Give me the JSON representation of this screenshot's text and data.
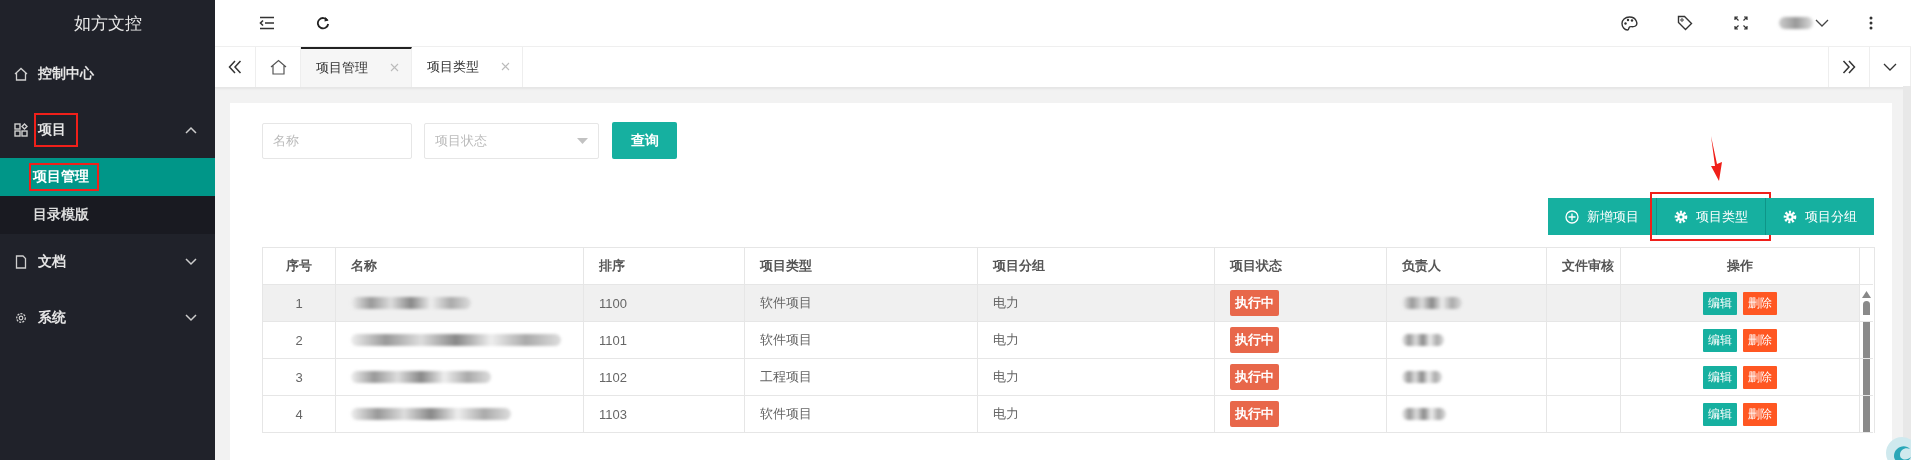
{
  "sidebar": {
    "title": "如方文控",
    "items": [
      {
        "label": "控制中心",
        "kind": "link"
      },
      {
        "label": "项目",
        "kind": "group",
        "expanded": true,
        "annotated": true,
        "children": [
          {
            "label": "项目管理",
            "selected": true,
            "annotated": true
          },
          {
            "label": "目录模版",
            "selected": false,
            "annotated": false
          }
        ]
      },
      {
        "label": "文档",
        "kind": "group",
        "expanded": false,
        "annotated": false
      },
      {
        "label": "系统",
        "kind": "group",
        "expanded": false,
        "annotated": false
      }
    ]
  },
  "tabs": [
    {
      "label": "项目管理",
      "selected": true
    },
    {
      "label": "项目类型",
      "selected": false
    }
  ],
  "search": {
    "name_placeholder": "名称",
    "status_placeholder": "项目状态",
    "button": "查询"
  },
  "toolbar": [
    {
      "label": "新增项目",
      "kind": "add",
      "annotated": false
    },
    {
      "label": "项目类型",
      "kind": "settings",
      "annotated": true
    },
    {
      "label": "项目分组",
      "kind": "settings",
      "annotated": false
    }
  ],
  "table": {
    "columns": [
      "序号",
      "名称",
      "排序",
      "项目类型",
      "项目分组",
      "项目状态",
      "负责人",
      "文件审核",
      "操作"
    ],
    "rows": [
      {
        "index": "1",
        "sort": "1100",
        "type": "软件项目",
        "group": "电力",
        "status": "执行中",
        "actions": [
          "编辑",
          "删除"
        ],
        "selected": true
      },
      {
        "index": "2",
        "sort": "1101",
        "type": "软件项目",
        "group": "电力",
        "status": "执行中",
        "actions": [
          "编辑",
          "删除"
        ],
        "selected": false
      },
      {
        "index": "3",
        "sort": "1102",
        "type": "工程项目",
        "group": "电力",
        "status": "执行中",
        "actions": [
          "编辑",
          "删除"
        ],
        "selected": false
      },
      {
        "index": "4",
        "sort": "1103",
        "type": "软件项目",
        "group": "电力",
        "status": "执行中",
        "actions": [
          "编辑",
          "删除"
        ],
        "selected": false
      }
    ]
  }
}
